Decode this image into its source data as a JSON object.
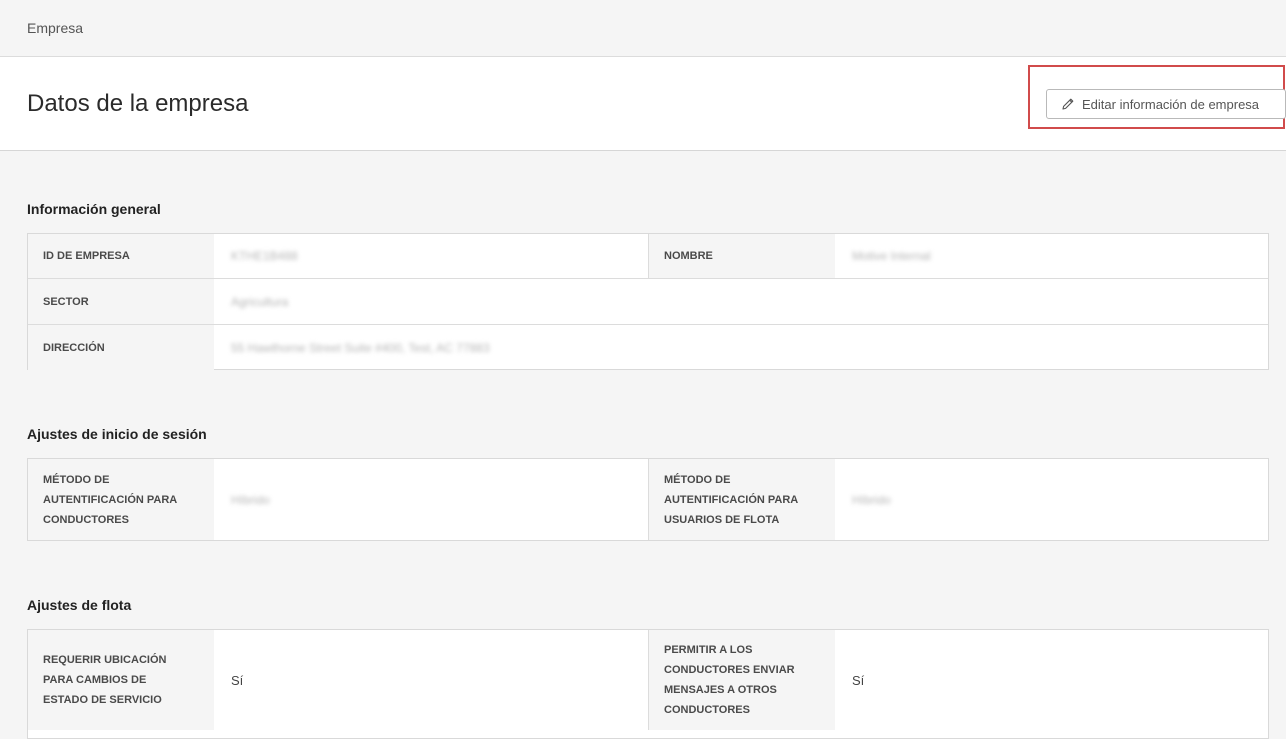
{
  "breadcrumb": "Empresa",
  "page_title": "Datos de la empresa",
  "edit_button_label": "Editar información de empresa",
  "sections": {
    "general": {
      "title": "Información general",
      "company_id_label": "ID DE EMPRESA",
      "company_id_value": "KTHE1B488",
      "name_label": "NOMBRE",
      "name_value": "Motive Internal",
      "sector_label": "SECTOR",
      "sector_value": "Agricultura",
      "address_label": "DIRECCIÓN",
      "address_value": "55 Hawthorne Street Suite #400, Test, AC 77883"
    },
    "login": {
      "title": "Ajustes de inicio de sesión",
      "drivers_auth_label": "MÉTODO DE AUTENTIFICACIÓN PARA CONDUCTORES",
      "drivers_auth_value": "Híbrido",
      "fleet_auth_label": "MÉTODO DE AUTENTIFICACIÓN PARA USUARIOS DE FLOTA",
      "fleet_auth_value": "Híbrido"
    },
    "fleet": {
      "title": "Ajustes de flota",
      "require_location_label": "REQUERIR UBICACIÓN PARA CAMBIOS DE ESTADO DE SERVICIO",
      "require_location_value": "Sí",
      "allow_messages_label": "PERMITIR A LOS CONDUCTORES ENVIAR MENSAJES A OTROS CONDUCTORES",
      "allow_messages_value": "Sí"
    }
  },
  "colors": {
    "highlight": "#d14b4b",
    "label_bg": "#f5f5f5"
  }
}
